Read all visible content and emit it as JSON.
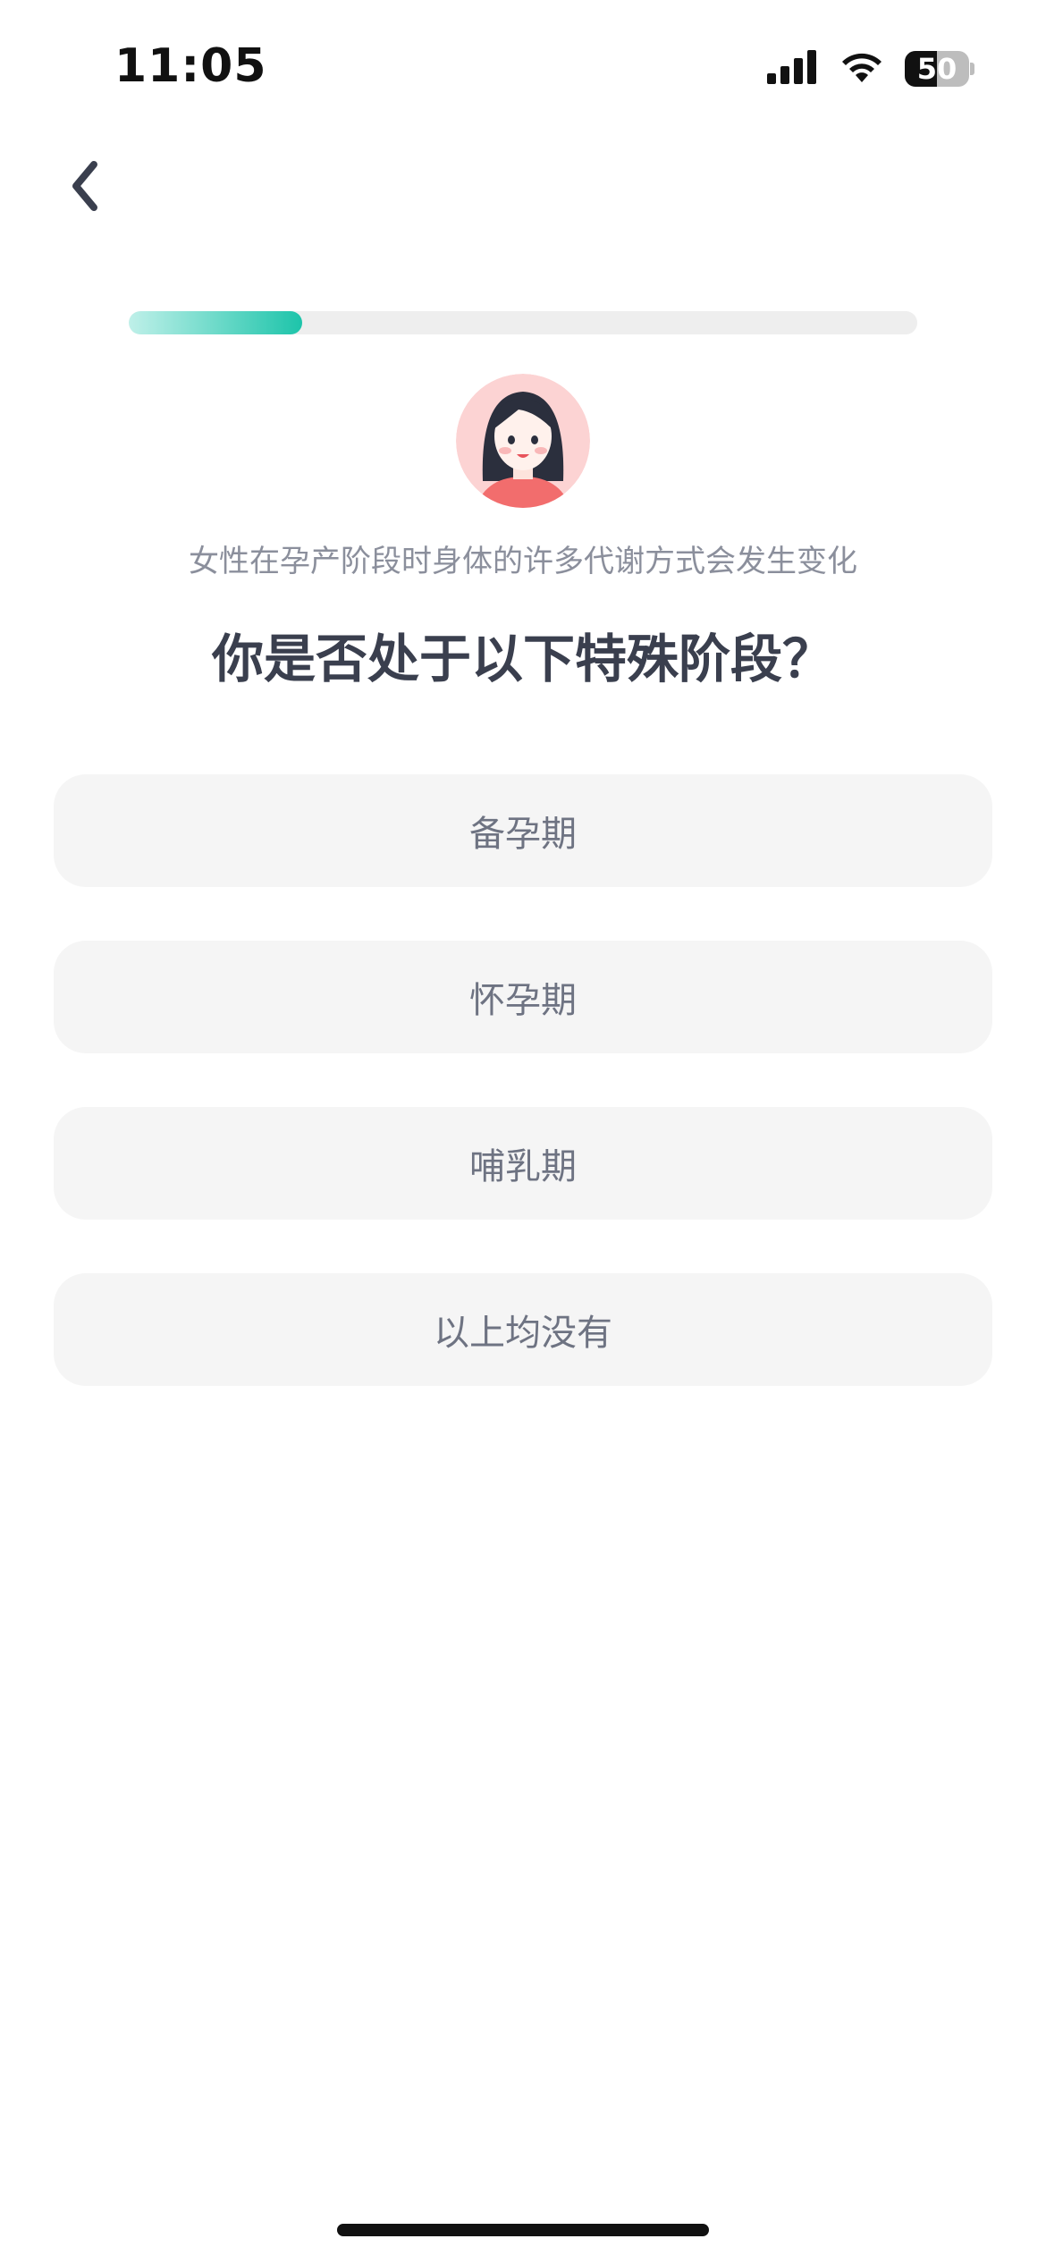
{
  "status_bar": {
    "time": "11:05",
    "battery_level": "50",
    "battery_percent": 50,
    "signal_icon": "cellular-signal-icon",
    "wifi_icon": "wifi-icon"
  },
  "nav": {
    "back_icon": "chevron-left-icon"
  },
  "progress": {
    "fraction": 0.22,
    "track_color": "#eeeeee",
    "fill_colors": [
      "#bff0e9",
      "#1dc4aa"
    ]
  },
  "avatar": {
    "icon": "woman-avatar-icon",
    "background_color": "#fcd3d3"
  },
  "content": {
    "subtitle": "女性在孕产阶段时身体的许多代谢方式会发生变化",
    "question": "你是否处于以下特殊阶段？",
    "options": [
      {
        "label": "备孕期"
      },
      {
        "label": "怀孕期"
      },
      {
        "label": "哺乳期"
      },
      {
        "label": "以上均没有"
      }
    ]
  },
  "colors": {
    "text_primary": "#3a3f4e",
    "text_secondary": "#8b8f9c",
    "option_background": "#f5f5f5",
    "accent": "#1dc4aa"
  }
}
